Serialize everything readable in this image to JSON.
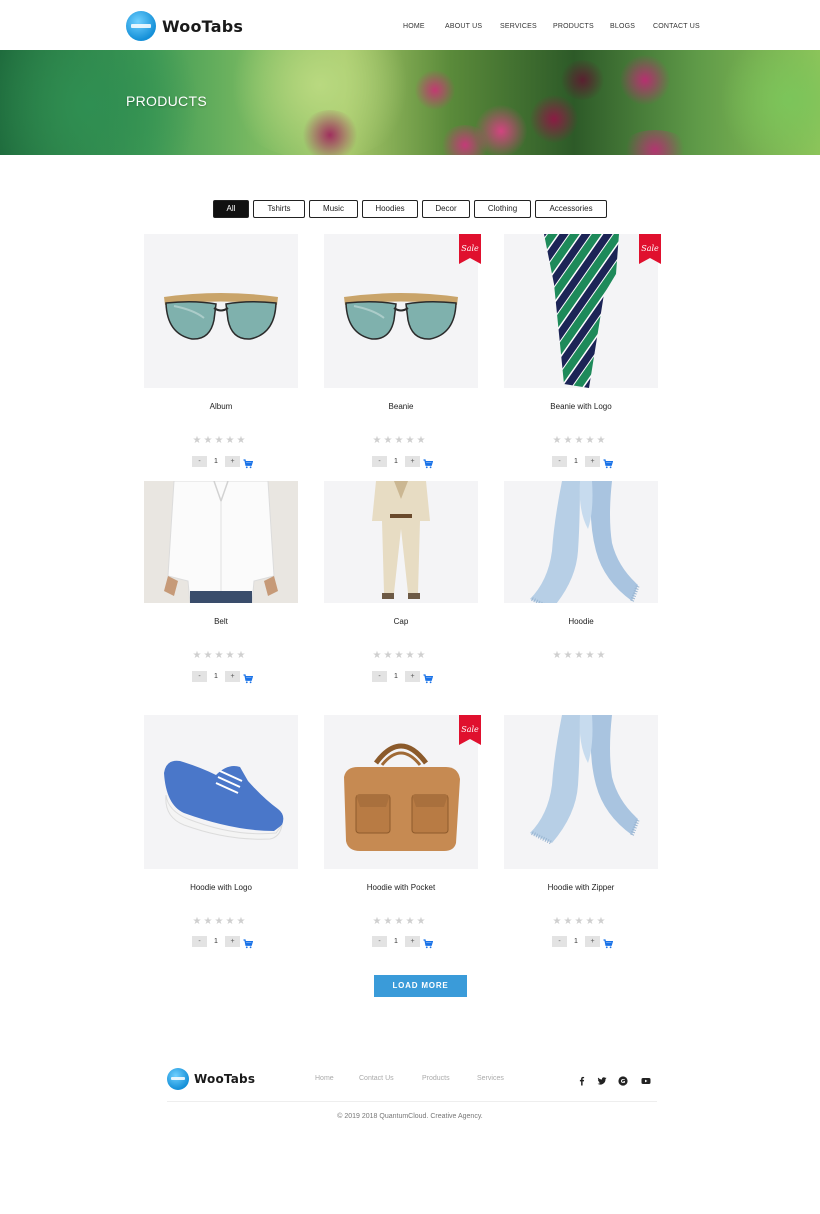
{
  "brand": {
    "name": "WooTabs"
  },
  "nav": {
    "items": [
      "HOME",
      "ABOUT US",
      "SERVICES",
      "PRODUCTS",
      "BLOGS",
      "CONTACT US"
    ]
  },
  "hero": {
    "title": "PRODUCTS"
  },
  "filters": {
    "items": [
      "All",
      "Tshirts",
      "Music",
      "Hoodies",
      "Decor",
      "Clothing",
      "Accessories"
    ],
    "active": "All"
  },
  "products": [
    {
      "name": "Album",
      "image": "sunglasses",
      "sale": false,
      "rating": 0,
      "qty": "1",
      "has_cart": true
    },
    {
      "name": "Beanie",
      "image": "sunglasses",
      "sale": true,
      "rating": 0,
      "qty": "1",
      "has_cart": true
    },
    {
      "name": "Beanie with Logo",
      "image": "striped-tie",
      "sale": true,
      "rating": 0,
      "qty": "1",
      "has_cart": true
    },
    {
      "name": "Belt",
      "image": "white-shirt",
      "sale": false,
      "rating": 0,
      "qty": "1",
      "has_cart": true
    },
    {
      "name": "Cap",
      "image": "beige-suit",
      "sale": false,
      "rating": 0,
      "qty": "1",
      "has_cart": true
    },
    {
      "name": "Hoodie",
      "image": "blue-scarf",
      "sale": false,
      "rating": 0,
      "qty": null,
      "has_cart": false
    },
    {
      "name": "Hoodie with Logo",
      "image": "blue-sneaker",
      "sale": false,
      "rating": 0,
      "qty": "1",
      "has_cart": true
    },
    {
      "name": "Hoodie with Pocket",
      "image": "leather-bag",
      "sale": true,
      "rating": 0,
      "qty": "1",
      "has_cart": true
    },
    {
      "name": "Hoodie with Zipper",
      "image": "blue-scarf",
      "sale": false,
      "rating": 0,
      "qty": "1",
      "has_cart": true
    }
  ],
  "labels": {
    "sale": "Sale",
    "minus": "-",
    "plus": "+",
    "load_more": "LOAD MORE"
  },
  "footer": {
    "brand": "WooTabs",
    "links": [
      "Home",
      "Contact Us",
      "Products",
      "Services"
    ],
    "social": [
      "facebook-icon",
      "twitter-icon",
      "google-plus-icon",
      "youtube-icon"
    ],
    "copyright": "© 2019 2018 QuantumCloud. Creative Agency."
  },
  "colors": {
    "accent": "#3a9bd9",
    "sale": "#e0102e",
    "cart": "#1a73e8",
    "star": "#cfcfcf"
  }
}
